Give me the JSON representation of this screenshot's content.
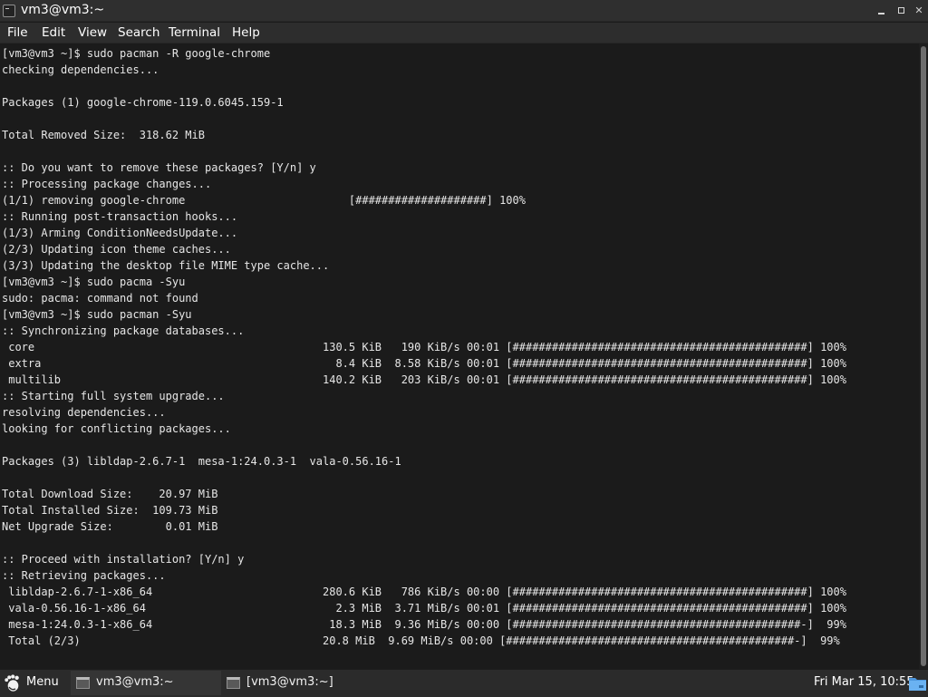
{
  "window": {
    "title": "vm3@vm3:~"
  },
  "menubar": {
    "items": [
      "File",
      "Edit",
      "View",
      "Search",
      "Terminal",
      "Help"
    ]
  },
  "terminal": {
    "lines": [
      "[vm3@vm3 ~]$ sudo pacman -R google-chrome",
      "checking dependencies...",
      "",
      "Packages (1) google-chrome-119.0.6045.159-1",
      "",
      "Total Removed Size:  318.62 MiB",
      "",
      ":: Do you want to remove these packages? [Y/n] y",
      ":: Processing package changes...",
      "(1/1) removing google-chrome                         [####################] 100%",
      ":: Running post-transaction hooks...",
      "(1/3) Arming ConditionNeedsUpdate...",
      "(2/3) Updating icon theme caches...",
      "(3/3) Updating the desktop file MIME type cache...",
      "[vm3@vm3 ~]$ sudo pacma -Syu",
      "sudo: pacma: command not found",
      "[vm3@vm3 ~]$ sudo pacman -Syu",
      ":: Synchronizing package databases...",
      " core                                            130.5 KiB   190 KiB/s 00:01 [#############################################] 100%",
      " extra                                             8.4 KiB  8.58 KiB/s 00:01 [#############################################] 100%",
      " multilib                                        140.2 KiB   203 KiB/s 00:01 [#############################################] 100%",
      ":: Starting full system upgrade...",
      "resolving dependencies...",
      "looking for conflicting packages...",
      "",
      "Packages (3) libldap-2.6.7-1  mesa-1:24.0.3-1  vala-0.56.16-1",
      "",
      "Total Download Size:    20.97 MiB",
      "Total Installed Size:  109.73 MiB",
      "Net Upgrade Size:        0.01 MiB",
      "",
      ":: Proceed with installation? [Y/n] y",
      ":: Retrieving packages...",
      " libldap-2.6.7-1-x86_64                          280.6 KiB   786 KiB/s 00:00 [#############################################] 100%",
      " vala-0.56.16-1-x86_64                             2.3 MiB  3.71 MiB/s 00:01 [#############################################] 100%",
      " mesa-1:24.0.3-1-x86_64                           18.3 MiB  9.36 MiB/s 00:00 [############################################-]  99%",
      " Total (2/3)                                     20.8 MiB  9.69 MiB/s 00:00 [############################################-]  99%"
    ]
  },
  "taskbar": {
    "menu_label": "Menu",
    "tasks": [
      {
        "label": "vm3@vm3:~",
        "active": true
      },
      {
        "label": "[vm3@vm3:~]",
        "active": false
      }
    ],
    "clock": "Fri Mar 15, 10:55"
  },
  "icons": {
    "app": "terminal-icon",
    "minimize": "minimize-icon",
    "maximize": "maximize-icon",
    "close": "close-icon",
    "menu": "gnome-foot-icon",
    "task": "terminal-window-icon",
    "tray": "folder-icon"
  },
  "colors": {
    "terminal_background": "#1b1b1b",
    "terminal_foreground": "#e6e6e6",
    "taskbar_background": "#2b2b2b"
  }
}
